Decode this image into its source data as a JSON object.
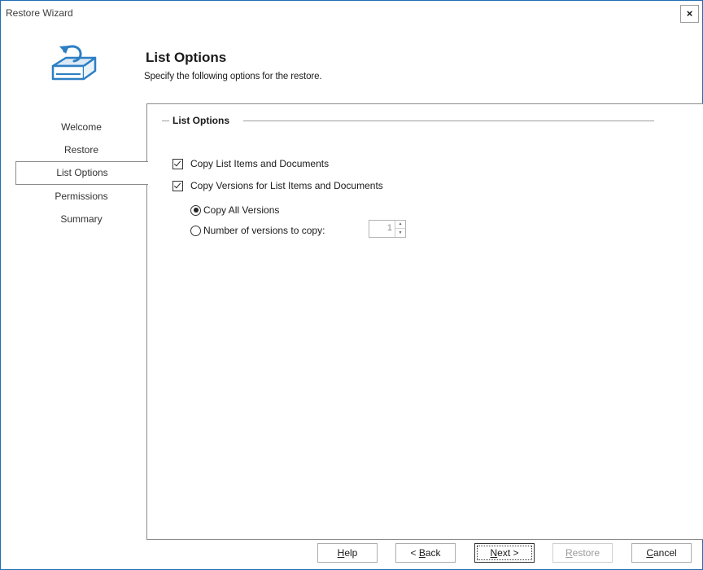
{
  "window": {
    "title": "Restore Wizard",
    "close_label": "×"
  },
  "header": {
    "title": "List Options",
    "subtitle": "Specify the following options for the restore.",
    "icon": "restore-database-icon"
  },
  "nav": {
    "items": [
      {
        "label": "Welcome"
      },
      {
        "label": "Restore"
      },
      {
        "label": "List Options"
      },
      {
        "label": "Permissions"
      },
      {
        "label": "Summary"
      }
    ],
    "active": "List Options"
  },
  "group": {
    "label": "List Options",
    "options": {
      "copy_items": {
        "label": "Copy List Items and Documents",
        "checked": true
      },
      "copy_versions": {
        "label": "Copy Versions for List Items and Documents",
        "checked": true
      },
      "copy_all_versions": {
        "label": "Copy All Versions",
        "selected": true
      },
      "number_versions": {
        "label": "Number of versions to copy:",
        "selected": false,
        "value": "1"
      }
    }
  },
  "buttons": {
    "help": {
      "u": "H",
      "rest": "elp"
    },
    "back": {
      "pre": "< ",
      "u": "B",
      "rest": "ack"
    },
    "next": {
      "u": "N",
      "rest": "ext >"
    },
    "restore": {
      "u": "R",
      "rest": "estore"
    },
    "cancel": {
      "u": "C",
      "rest": "ancel"
    }
  },
  "colors": {
    "accent": "#1f6fb5",
    "icon_blue": "#2d7fc4"
  }
}
